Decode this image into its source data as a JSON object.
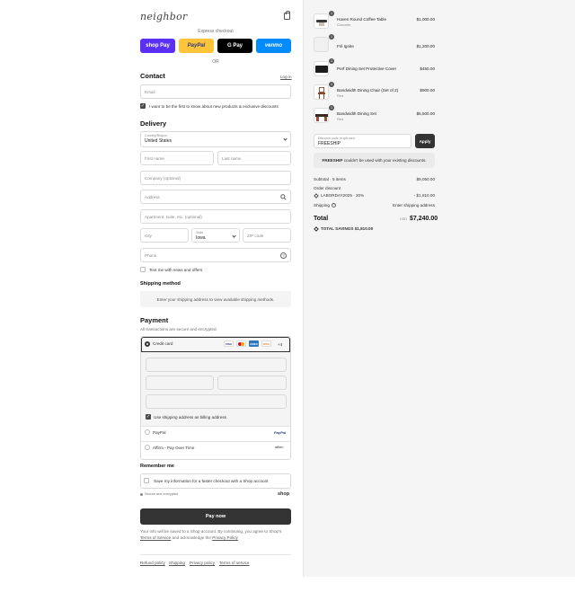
{
  "brand": {
    "logo_text": "neighbor"
  },
  "express": {
    "label": "Express checkout",
    "buttons": [
      {
        "label": "shop Pay",
        "bg": "#5a31f4",
        "fg": "#ffffff"
      },
      {
        "label": "PayPal",
        "bg": "#ffc439",
        "fg": "#253b80"
      },
      {
        "label": "G Pay",
        "bg": "#000000",
        "fg": "#ffffff"
      },
      {
        "label": "venmo",
        "bg": "#008cff",
        "fg": "#ffffff"
      }
    ],
    "or": "OR"
  },
  "contact": {
    "title": "Contact",
    "login": "Log in",
    "email_placeholder": "Email",
    "newsletter": "I want to be the first to know about new products & exclusive discounts"
  },
  "delivery": {
    "title": "Delivery",
    "country_label": "Country/Region",
    "country_value": "United States",
    "first_name": "First name",
    "last_name": "Last name",
    "company": "Company (optional)",
    "address": "Address",
    "apartment": "Apartment, suite, etc. (optional)",
    "city": "City",
    "state_label": "State",
    "state_value": "Iowa",
    "zip": "ZIP code",
    "phone": "Phone",
    "text_me": "Text me with news and offers"
  },
  "shipping": {
    "title": "Shipping method",
    "placeholder": "Enter your shipping address to view available shipping methods."
  },
  "payment": {
    "title": "Payment",
    "subtitle": "All transactions are secure and encrypted.",
    "credit_card": "Credit card",
    "card_brands": [
      "VISA",
      "MC",
      "AMEX",
      "DISC"
    ],
    "more_brands": "+4",
    "billing_same": "Use shipping address as billing address",
    "paypal": "PayPal",
    "paypal_logo": "PayPal",
    "affirm": "Affirm - Pay Over Time",
    "affirm_logo": "affirm"
  },
  "remember": {
    "title": "Remember me",
    "save_info": "Save my information for a faster checkout with a Shop account",
    "secure": "Secure and encrypted",
    "shop_logo": "shop"
  },
  "pay_now": "Pay now",
  "legal": {
    "line1": "Your info will be saved to a Shop account. By continuing, you agree to Shop's",
    "terms": "Terms of Service",
    "and": "and acknowledge the",
    "privacy": "Privacy Policy"
  },
  "footer_links": [
    "Refund policy",
    "Shipping",
    "Privacy policy",
    "Terms of service"
  ],
  "cart": {
    "items": [
      {
        "qty": "1",
        "name": "Haven Round Coffee Table",
        "sub": "Concrete",
        "price": "$1,000.00"
      },
      {
        "qty": "1",
        "name": "Fril Ignite",
        "sub": "",
        "price": "$1,200.00"
      },
      {
        "qty": "1",
        "name": "Perf Dining Set Protective Cover",
        "sub": "",
        "price": "$450.00"
      },
      {
        "qty": "1",
        "name": "Bandwidth Dining Chair (Set of 2)",
        "sub": "Red",
        "price": "$900.00"
      },
      {
        "qty": "1",
        "name": "Bandwidth Dining Set",
        "sub": "Red",
        "price": "$5,500.00"
      }
    ],
    "discount_label": "Discount code or gift card",
    "discount_value": "FREESHIP",
    "apply": "Apply",
    "notice_code": "FREESHIP",
    "notice_text": "couldn't be used with your existing discounts.",
    "subtotal_label": "Subtotal · 5 items",
    "subtotal_value": "$9,050.00",
    "order_discount_label": "Order discount",
    "discount_code": "LABORDAY2025 · 20%",
    "discount_amount": "- $1,810.00",
    "shipping_label": "Shipping",
    "shipping_value": "Enter shipping address",
    "total_label": "Total",
    "currency": "USD",
    "total_value": "$7,240.00",
    "savings_label": "TOTAL SAVINGS",
    "savings_value": "$1,810.00"
  }
}
